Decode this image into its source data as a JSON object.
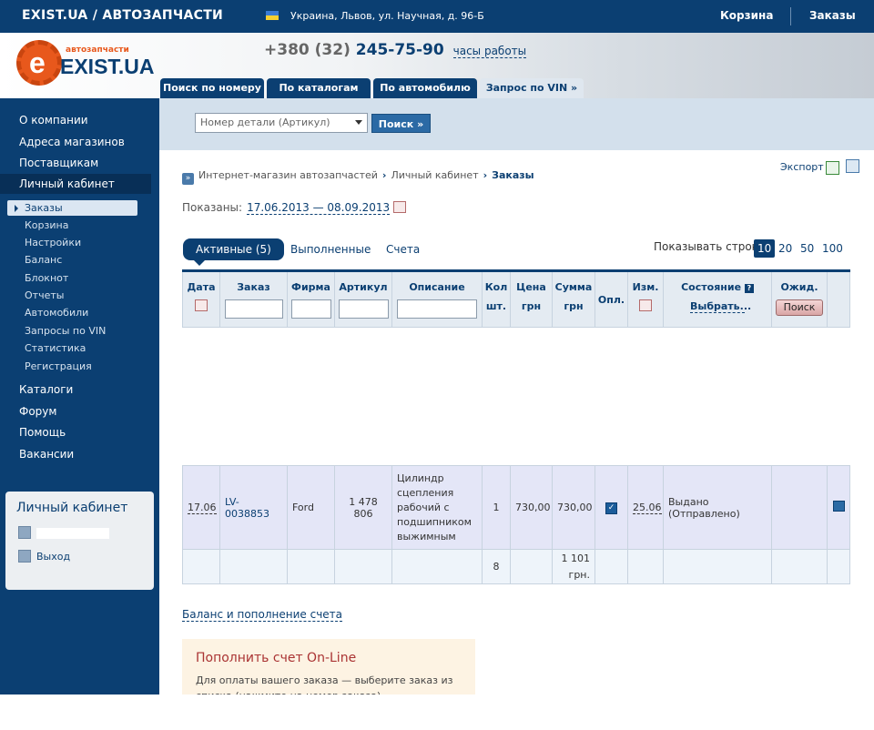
{
  "topbar": {
    "brand": "EXIST.UA / АВТОЗАПЧАСТИ",
    "address": "Украина, Львов, ул. Научная, д. 96-Б",
    "cart": "Корзина",
    "orders": "Заказы"
  },
  "header": {
    "logo_small": "автозапчасти",
    "logo_big": "EXIST.UA",
    "phone_prefix": "+380 (32)",
    "phone_number": "245-75-90",
    "hours_link": "часы работы",
    "tabs": [
      "Поиск по номеру",
      "По каталогам",
      "По автомобилю",
      "Запрос по VIN »"
    ]
  },
  "sidebar": {
    "top_items": [
      "О компании",
      "Адреса магазинов",
      "Поставщикам"
    ],
    "selected": "Личный кабинет",
    "sub_items": [
      "Заказы",
      "Корзина",
      "Настройки",
      "Баланс",
      "Блокнот",
      "Отчеты",
      "Автомобили",
      "Запросы по VIN",
      "Статистика",
      "Регистрация"
    ],
    "bottom_items": [
      "Каталоги",
      "Форум",
      "Помощь",
      "Вакансии"
    ],
    "cabinet_title": "Личный кабинет",
    "logout": "Выход"
  },
  "search": {
    "select_value": "Номер детали (Артикул)",
    "button": "Поиск »"
  },
  "breadcrumbs": {
    "items": [
      "Интернет-магазин автозапчастей",
      "Личный кабинет"
    ],
    "current": "Заказы"
  },
  "export": "Экспорт",
  "period": {
    "label": "Показаны:",
    "range": "17.06.2013 — 08.09.2013"
  },
  "order_tabs": [
    "Активные (5)",
    "Выполненные",
    "Счета"
  ],
  "rows_label": "Показывать строк:",
  "rows_options": [
    "10",
    "20",
    "50",
    "100"
  ],
  "rows_selected": "10",
  "table": {
    "headers": {
      "date": "Дата",
      "order": "Заказ",
      "firm": "Фирма",
      "article": "Артикул",
      "description": "Описание",
      "qty": "Кол",
      "qty_unit": "шт.",
      "price": "Цена",
      "price_unit": "грн",
      "sum": "Сумма",
      "sum_unit": "грн",
      "paid": "Опл.",
      "changed": "Изм.",
      "status": "Состояние",
      "status_help": "?",
      "status_choose": "Выбрать...",
      "expected": "Ожид.",
      "search_btn": "Поиск"
    },
    "row": {
      "date": "17.06",
      "order": "LV-0038853",
      "firm": "Ford",
      "article": "1 478 806",
      "description": "Цилиндр сцепления рабочий с подшипником выжимным",
      "qty": "1",
      "price": "730,00",
      "sum": "730,00",
      "changed": "25.06",
      "status": "Выдано (Отправлено)"
    },
    "totals": {
      "qty": "8",
      "sum": "1 101 грн."
    }
  },
  "balance_link": "Баланс и пополнение счета",
  "online": {
    "title": "Пополнить счет On-Line",
    "text": "Для оплаты вашего заказа — выберите заказ из списка (нажмите на номер заказа)"
  }
}
